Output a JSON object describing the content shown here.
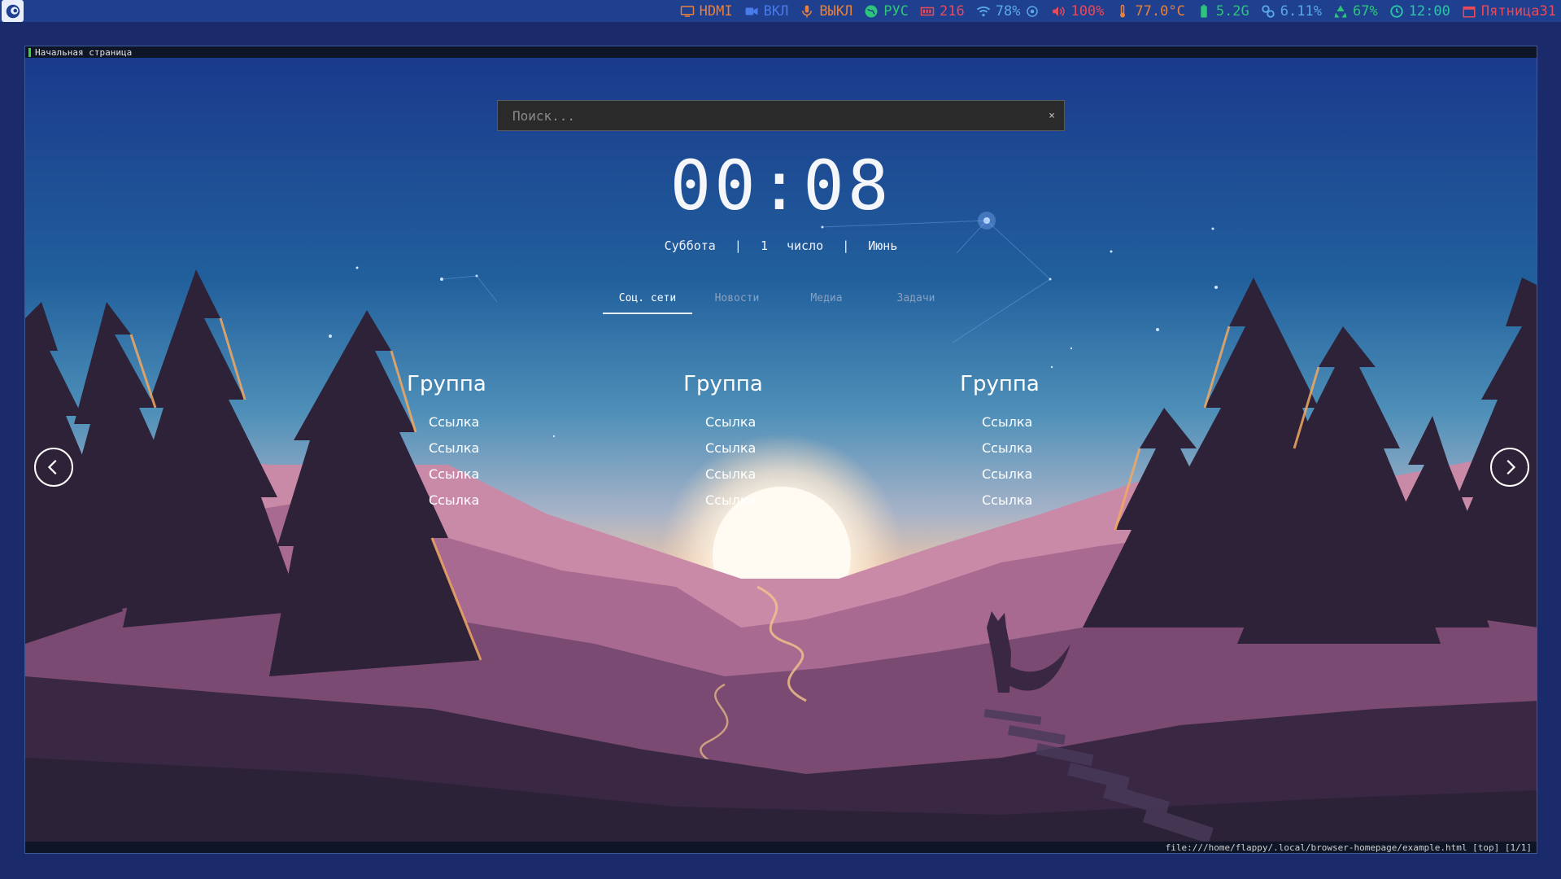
{
  "statusbar": {
    "items": [
      {
        "icon": "monitor-icon",
        "text": "HDMI",
        "color": "#e8803a"
      },
      {
        "icon": "camera-icon",
        "text": "ВКЛ",
        "color": "#4a7bea"
      },
      {
        "icon": "microphone-icon",
        "text": "ВЫКЛ",
        "color": "#e8803a"
      },
      {
        "icon": "globe-icon",
        "text": "РУС",
        "color": "#2ec47a"
      },
      {
        "icon": "memory-icon",
        "text": "216",
        "color": "#e84a5a"
      },
      {
        "icon": "wifi-icon",
        "text": "78%",
        "color": "#5aa8ea"
      },
      {
        "icon": "volume-icon",
        "text": "100%",
        "color": "#e84a5a"
      },
      {
        "icon": "thermometer-icon",
        "text": "77.0°C",
        "color": "#e8803a"
      },
      {
        "icon": "battery-icon",
        "text": "5.2G",
        "color": "#2ec47a"
      },
      {
        "icon": "cpu-icon",
        "text": "6.11%",
        "color": "#5aa8ea"
      },
      {
        "icon": "recycle-icon",
        "text": "67%",
        "color": "#2ec47a"
      },
      {
        "icon": "clock-icon",
        "text": "12:00",
        "color": "#2ec4a8"
      },
      {
        "icon": "calendar-icon",
        "text": "Пятница31",
        "color": "#e84a5a"
      }
    ]
  },
  "browser": {
    "tab_title": "Начальная страница",
    "status_url": "file:///home/flappy/.local/browser-homepage/example.html [top] [1/1]"
  },
  "search": {
    "placeholder": "Поиск...",
    "clear": "×"
  },
  "clock": "00:08",
  "date": {
    "weekday": "Суббота",
    "sep": "|",
    "day": "1",
    "day_word": "число",
    "month": "Июнь"
  },
  "tabs": [
    {
      "label": "Соц. сети",
      "active": true
    },
    {
      "label": "Новости",
      "active": false
    },
    {
      "label": "Медиа",
      "active": false
    },
    {
      "label": "Задачи",
      "active": false
    }
  ],
  "groups": [
    {
      "title": "Группа",
      "links": [
        "Ссылка",
        "Ссылка",
        "Ссылка",
        "Ссылка"
      ]
    },
    {
      "title": "Группа",
      "links": [
        "Ссылка",
        "Ссылка",
        "Ссылка",
        "Ссылка"
      ]
    },
    {
      "title": "Группа",
      "links": [
        "Ссылка",
        "Ссылка",
        "Ссылка",
        "Ссылка"
      ]
    }
  ]
}
